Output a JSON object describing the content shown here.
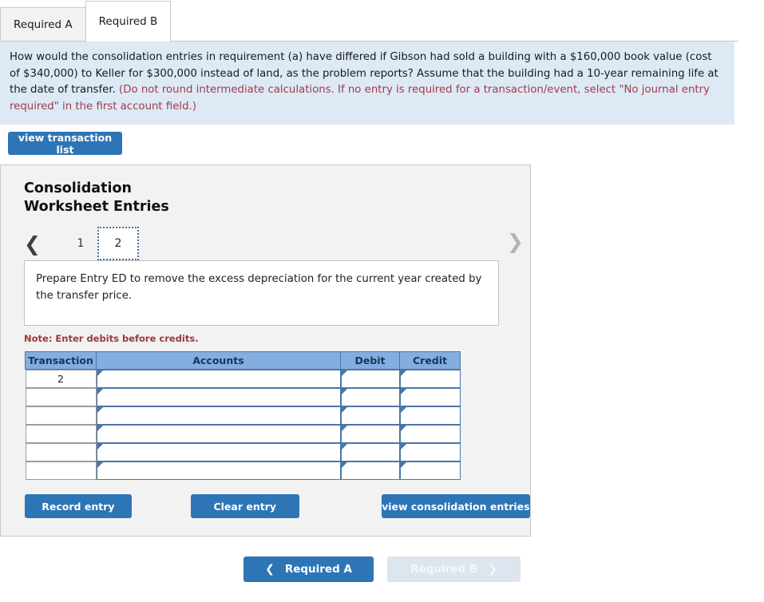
{
  "tabs": [
    {
      "label": "Required A",
      "active": false
    },
    {
      "label": "Required B",
      "active": true
    }
  ],
  "question": {
    "body_part_1": "How would the consolidation entries in requirement (a) have differed if Gibson had sold a building with a $160,000 book value (cost of $340,000) to Keller for $300,000 instead of land, as the problem reports? Assume that the building had a 10-year remaining life at the date of transfer. ",
    "hint": "(Do not round intermediate calculations. If no entry is required for a transaction/event, select \"No journal entry required\" in the first account field.)"
  },
  "toolbar": {
    "view_transaction_list_label": "view transaction list"
  },
  "panel": {
    "title_line_1": "Consolidation",
    "title_line_2": "Worksheet Entries",
    "pager": {
      "prev_icon": "chevron-left",
      "next_icon": "chevron-right",
      "pages": [
        {
          "label": "1",
          "active": false
        },
        {
          "label": "2",
          "active": true
        }
      ]
    },
    "instruction": "Prepare Entry ED to remove the excess depreciation for the current year created by the transfer price.",
    "note": "Note: Enter debits before credits.",
    "table": {
      "headers": [
        "Transaction",
        "Accounts",
        "Debit",
        "Credit"
      ],
      "rows": [
        {
          "transaction": "2",
          "accounts": "",
          "debit": "",
          "credit": ""
        },
        {
          "transaction": "",
          "accounts": "",
          "debit": "",
          "credit": ""
        },
        {
          "transaction": "",
          "accounts": "",
          "debit": "",
          "credit": ""
        },
        {
          "transaction": "",
          "accounts": "",
          "debit": "",
          "credit": ""
        },
        {
          "transaction": "",
          "accounts": "",
          "debit": "",
          "credit": ""
        },
        {
          "transaction": "",
          "accounts": "",
          "debit": "",
          "credit": ""
        }
      ]
    },
    "actions": {
      "record_entry_label": "Record entry",
      "clear_entry_label": "Clear entry",
      "view_consolidation_entries_label": "view consolidation entries"
    }
  },
  "bottom_nav": {
    "prev_label": "Required A",
    "next_label": "Required B",
    "prev_icon": "chevron-left",
    "next_icon": "chevron-right",
    "next_disabled": true
  },
  "colors": {
    "accent_blue": "#2e75b6",
    "table_header_blue": "#85aee0",
    "banner_blue": "#ddeaf6",
    "hint_red": "#a33a4a",
    "note_red": "#9a3a3a",
    "disabled_button": "#dde5ee"
  }
}
